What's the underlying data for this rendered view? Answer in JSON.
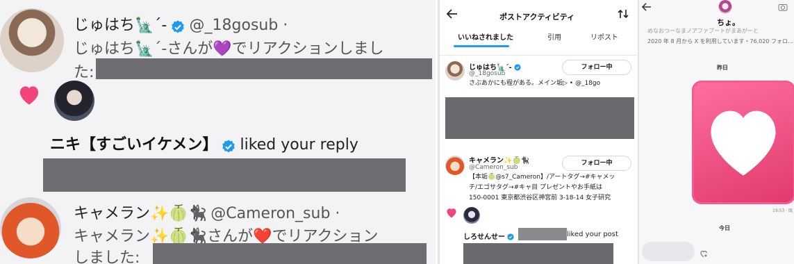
{
  "left": {
    "row1": {
      "name": "じゅはち🗽´-",
      "handle": "@_18gosub ·",
      "reaction_line1": "じゅはち🗽´-さんが💜でリアクションしまし",
      "reaction_line2": "た:"
    },
    "row2": {
      "name": "ニキ【すごいイケメン】",
      "action": "liked your reply"
    },
    "row3": {
      "name": "キャメラン✨🍈🐈‍⬛",
      "handle": "@Cameron_sub ·",
      "reaction_line1": "キャメラン✨🍈🐈‍⬛さんが❤️でリアクション",
      "reaction_line2": "しました:"
    },
    "colors": {
      "verified": "#1d9bf0",
      "heart": "#f0457a",
      "grey_block": "#6e6e72"
    }
  },
  "middle": {
    "header": {
      "title": "ポストアクティビティ",
      "back_icon": "arrow-left-icon",
      "sort_icon": "sort-icon"
    },
    "tabs": [
      "いいねされました",
      "引用",
      "リポスト"
    ],
    "users": [
      {
        "name": "じゅはち🗽´-",
        "handle": "@_18gosub",
        "follow_label": "フォロー中",
        "bio": [
          "さぶあかにも程がある。メイン垢▷ • @_18go"
        ]
      },
      {
        "name": "キャメラン✨🍈🐈‍⬛",
        "handle": "@Cameron_sub",
        "follow_label": "フォロー中",
        "bio": [
          "【本垢🍈@s7_Cameron】/アートタグ→#キャメッ",
          "チ/エゴサタグ→#キャ目 プレゼントやお手紙は",
          "150-0001 東京都渋谷区神宮前 3-18-14 女子研究"
        ]
      }
    ],
    "notification": {
      "name": "しろせんせー",
      "action": "liked your post"
    }
  },
  "right": {
    "back_icon": "arrow-left-icon",
    "camera_icon": "camera-icon",
    "name": "ちょ。",
    "partial_line": "めなおつーなまノアファブートがまあがーと",
    "meta": "2020 年 8 月から X を利用しています・76,020 フォロ…",
    "divider_yesterday": "昨日",
    "timestamp": "19:53 · 既",
    "divider_today": "今日",
    "add_reaction_icon": "add-reaction-icon"
  }
}
